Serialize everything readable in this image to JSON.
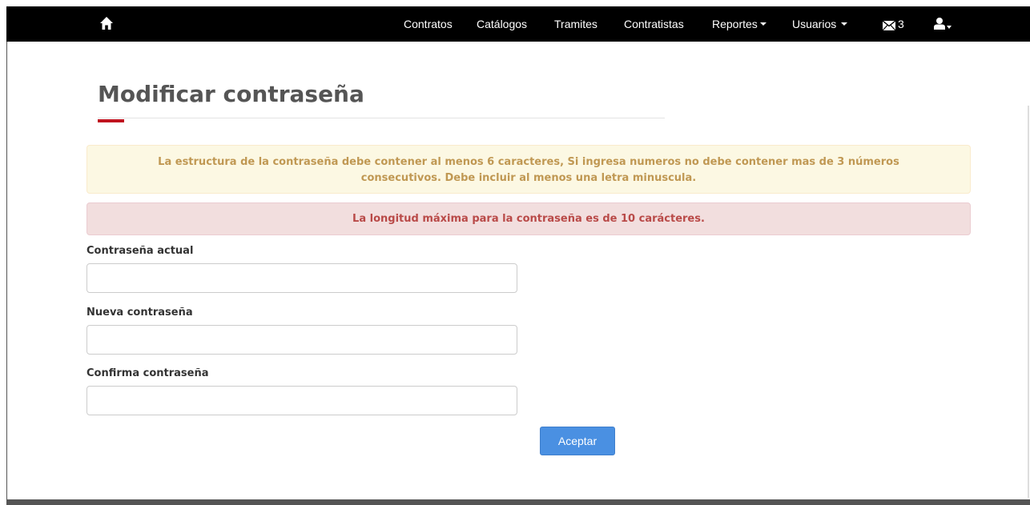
{
  "navbar": {
    "home_icon": "home-icon",
    "items": [
      {
        "label": "Contratos",
        "dropdown": false
      },
      {
        "label": "Catálogos",
        "dropdown": false
      },
      {
        "label": "Tramites",
        "dropdown": false
      },
      {
        "label": "Contratistas",
        "dropdown": false
      },
      {
        "label": "Reportes",
        "dropdown": true
      },
      {
        "label": "Usuarios",
        "dropdown": true
      }
    ],
    "mail_icon": "envelope-icon",
    "mail_count": "3",
    "user_icon": "user-icon"
  },
  "page": {
    "title": "Modificar contraseña",
    "accent_color": "#c0121f"
  },
  "alerts": {
    "warning": "La estructura de la contraseña debe contener al menos 6 caracteres, Si ingresa numeros no debe contener mas de 3 números consecutivos. Debe incluir al menos una letra minuscula.",
    "danger": "La longitud máxima para la contraseña es de 10 carácteres."
  },
  "form": {
    "current_password_label": "Contraseña actual",
    "current_password_value": "",
    "new_password_label": "Nueva contraseña",
    "new_password_value": "",
    "confirm_password_label": "Confirma contraseña",
    "confirm_password_value": "",
    "submit_label": "Aceptar",
    "submit_color": "#4a90e2"
  }
}
